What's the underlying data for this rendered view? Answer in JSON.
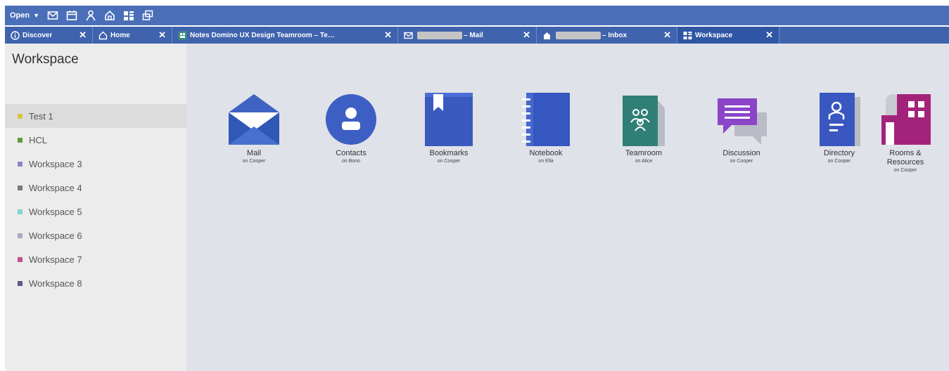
{
  "toolbar": {
    "open_label": "Open",
    "icons": [
      "mail-icon",
      "calendar-icon",
      "person-icon",
      "home-icon",
      "workspace-icon",
      "windows-icon"
    ]
  },
  "tabs": [
    {
      "label": "Discover",
      "icon": "info-icon",
      "active": false
    },
    {
      "label": "Home",
      "icon": "home-icon",
      "active": false
    },
    {
      "label": "Notes Domino UX Design Teamroom – Te…",
      "icon": "teamroom-icon",
      "active": false
    },
    {
      "label": "– Mail",
      "icon": "mail-icon",
      "active": false,
      "redacted": true
    },
    {
      "label": "– Inbox",
      "icon": "database-icon",
      "active": false,
      "redacted": true
    },
    {
      "label": "Workspace",
      "icon": "workspace-icon",
      "active": true
    }
  ],
  "sidebar": {
    "title": "Workspace",
    "items": [
      {
        "label": "Test 1",
        "color": "#d6c63f",
        "selected": true
      },
      {
        "label": "HCL",
        "color": "#5f9e3c"
      },
      {
        "label": "Workspace 3",
        "color": "#8a86c9"
      },
      {
        "label": "Workspace 4",
        "color": "#7a7a7a"
      },
      {
        "label": "Workspace 5",
        "color": "#7fd6d6"
      },
      {
        "label": "Workspace 6",
        "color": "#a8a9c4"
      },
      {
        "label": "Workspace 7",
        "color": "#c34d91"
      },
      {
        "label": "Workspace 8",
        "color": "#5c5a86"
      }
    ]
  },
  "apps": [
    {
      "name": "Mail",
      "server": "on Cooper",
      "icon": "mail-app-icon"
    },
    {
      "name": "Contacts",
      "server": "on Bono",
      "icon": "contacts-app-icon"
    },
    {
      "name": "Bookmarks",
      "server": "on Cooper",
      "icon": "bookmarks-app-icon"
    },
    {
      "name": "Notebook",
      "server": "on Ella",
      "icon": "notebook-app-icon"
    },
    {
      "name": "Teamroom",
      "server": "on Alice",
      "icon": "teamroom-app-icon"
    },
    {
      "name": "Discussion",
      "server": "on Cooper",
      "icon": "discussion-app-icon"
    },
    {
      "name": "Directory",
      "server": "on Cooper",
      "icon": "directory-app-icon"
    },
    {
      "name": "Rooms & Resources",
      "server": "on Cooper",
      "icon": "rooms-resources-app-icon"
    }
  ],
  "colors": {
    "toolbar_bg": "#4a6fb8",
    "tabbar_bg": "#3f63ad",
    "active_tab_bg": "#2f56a4",
    "sidebar_bg": "#ececec",
    "main_bg": "#dfe2e8"
  }
}
